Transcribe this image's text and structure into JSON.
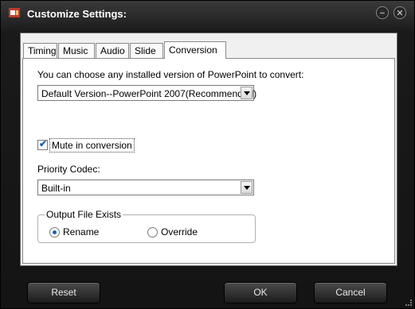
{
  "window": {
    "title": "Customize Settings:"
  },
  "titlebar_buttons": {
    "minimize": "−",
    "close": "✕"
  },
  "tabs": [
    {
      "label": "Timing"
    },
    {
      "label": "Music"
    },
    {
      "label": "Audio"
    },
    {
      "label": "Slide"
    },
    {
      "label": "Conversion"
    }
  ],
  "active_tab": "Conversion",
  "conversion": {
    "version_prompt": "You can choose any installed version of PowerPoint to convert:",
    "version_value": "Default Version--PowerPoint 2007(Recommended)",
    "mute_label": "Mute in conversion",
    "mute_checked": true,
    "codec_label": "Priority Codec:",
    "codec_value": "Built-in",
    "output_exists_title": "Output File Exists",
    "rename_label": "Rename",
    "override_label": "Override",
    "selected_option": "Rename"
  },
  "buttons": {
    "reset": "Reset",
    "ok": "OK",
    "cancel": "Cancel"
  },
  "colors": {
    "accent": "#1a5fb4",
    "frame": "#1e1e1e"
  }
}
